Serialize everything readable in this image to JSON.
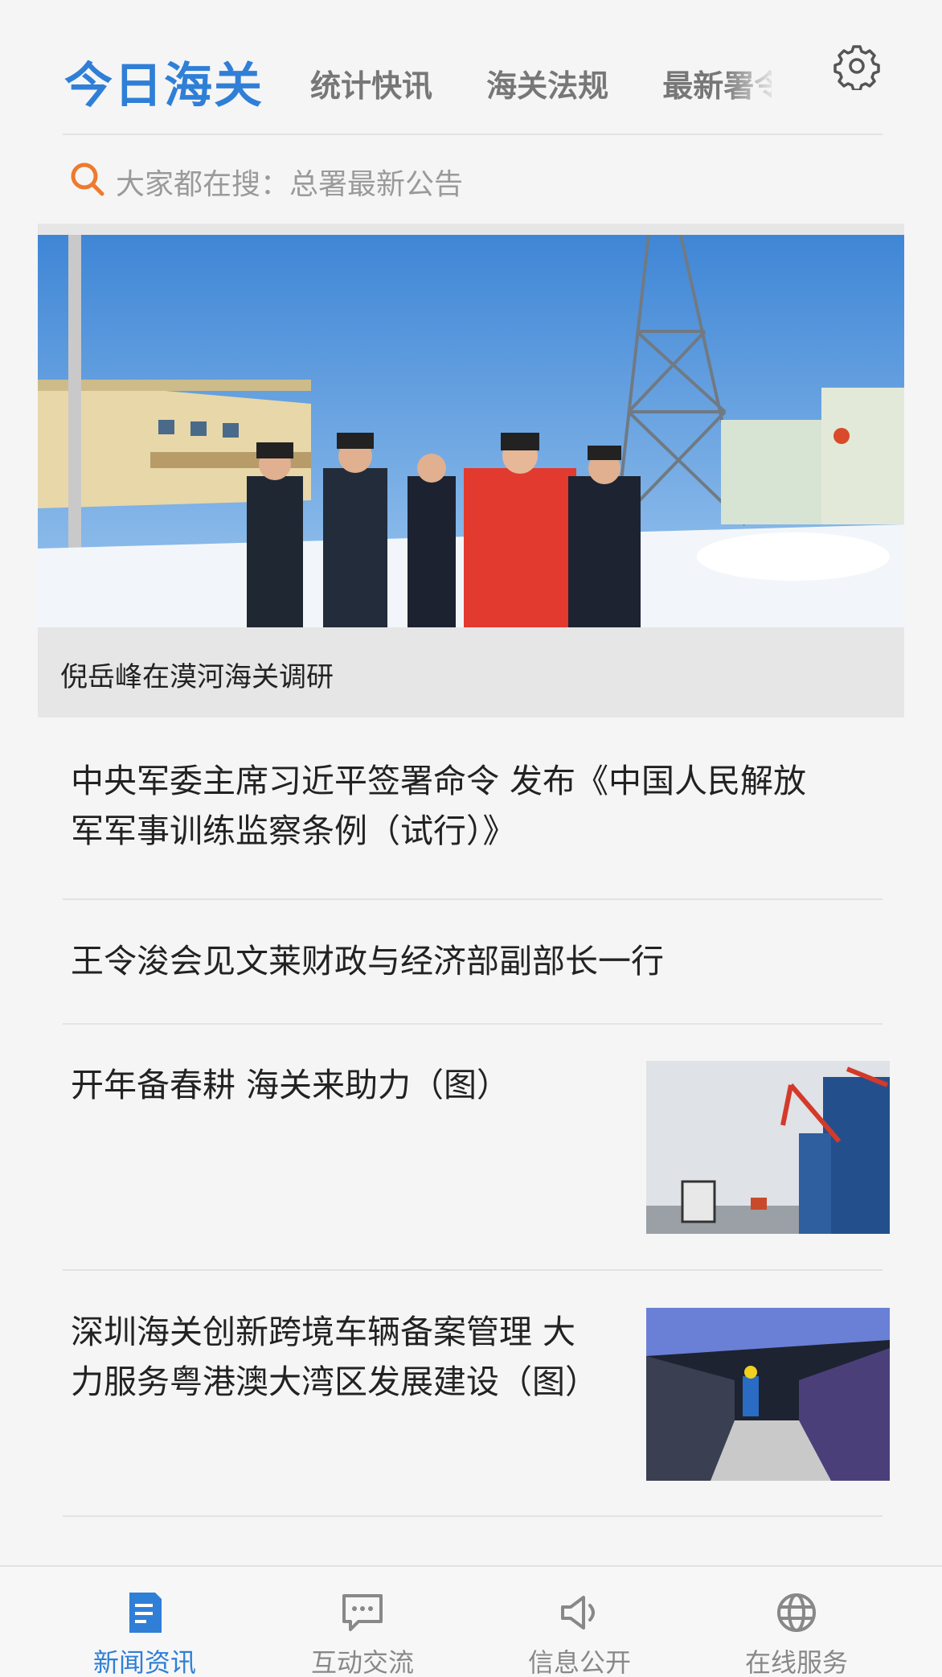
{
  "header": {
    "brand": "今日海关",
    "tabs": [
      "统计快讯",
      "海关法规",
      "最新署令"
    ],
    "settings_icon": "gear-icon",
    "accent_color": "#2f7fd7"
  },
  "search": {
    "placeholder": "大家都在搜：总署最新公告",
    "icon": "search-icon",
    "icon_color": "#ee7a2f"
  },
  "banner": {
    "caption": "倪岳峰在漠河海关调研"
  },
  "news": [
    {
      "title_lines": [
        "中央军委主席习近平签署命令 发布《中国人民解放",
        "军军事训练监察条例（试行）》"
      ],
      "has_thumb": false
    },
    {
      "title_lines": [
        "王令浚会见文莱财政与经济部副部长一行"
      ],
      "has_thumb": false
    },
    {
      "title_lines": [
        "开年备春耕 海关来助力（图）"
      ],
      "has_thumb": true,
      "thumb": "port-cranes-photo"
    },
    {
      "title_lines": [
        "深圳海关创新跨境车辆备案管理 大",
        "力服务粤港澳大湾区发展建设（图）"
      ],
      "has_thumb": true,
      "thumb": "vehicle-inspection-photo"
    }
  ],
  "bottom_nav": {
    "items": [
      {
        "label": "新闻资讯",
        "icon": "news-icon",
        "active": true
      },
      {
        "label": "互动交流",
        "icon": "chat-icon",
        "active": false
      },
      {
        "label": "信息公开",
        "icon": "megaphone-icon",
        "active": false
      },
      {
        "label": "在线服务",
        "icon": "globe-icon",
        "active": false
      }
    ]
  }
}
